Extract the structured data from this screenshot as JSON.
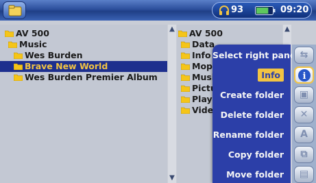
{
  "status": {
    "volume": "93",
    "battery_level": 0.75,
    "clock": "09:20"
  },
  "left_pane": {
    "items": [
      {
        "label": "AV 500",
        "indent": 0
      },
      {
        "label": "Music",
        "indent": 1
      },
      {
        "label": "Wes Burden",
        "indent": 2
      },
      {
        "label": "Brave New World",
        "indent": 3,
        "selected": true
      },
      {
        "label": "Wes Burden Premier Album",
        "indent": 3
      }
    ]
  },
  "right_pane": {
    "items": [
      {
        "label": "AV 500"
      },
      {
        "label": "Data"
      },
      {
        "label": "Info"
      },
      {
        "label": "Moph"
      },
      {
        "label": "Musi"
      },
      {
        "label": "Pictu"
      },
      {
        "label": "Playl"
      },
      {
        "label": "Video"
      }
    ]
  },
  "menu": {
    "items": [
      {
        "label": "Select right pane",
        "icon": "pane-switch-icon"
      },
      {
        "label": "Info",
        "icon": "info-icon",
        "highlight": true
      },
      {
        "label": "Create folder",
        "icon": "folder-create-icon"
      },
      {
        "label": "Delete folder",
        "icon": "delete-icon"
      },
      {
        "label": "Rename folder",
        "icon": "rename-icon"
      },
      {
        "label": "Copy folder",
        "icon": "copy-icon"
      },
      {
        "label": "Move folder",
        "icon": "move-icon"
      }
    ]
  },
  "colors": {
    "selection_bg": "#1d2f8e",
    "selection_text": "#f2c443",
    "menu_bg": "#2c3fa8",
    "highlight": "#f2c443",
    "folder": "#f5c518"
  }
}
